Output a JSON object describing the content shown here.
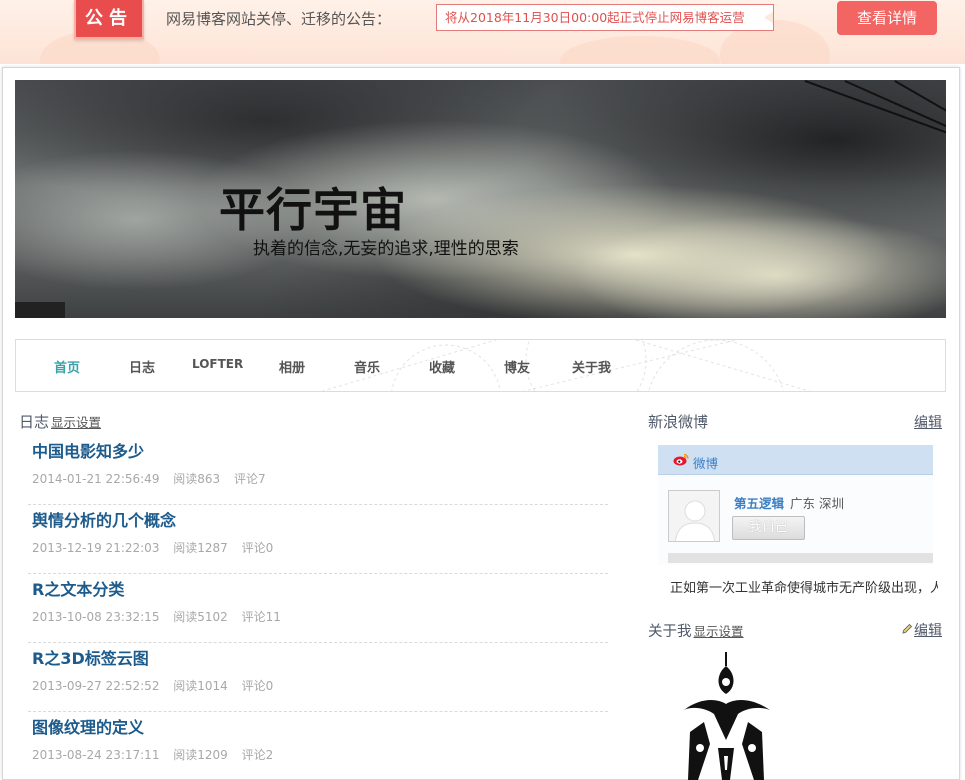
{
  "notice": {
    "tag": "公告",
    "text": "网易博客网站关停、迁移的公告：",
    "box_text": "将从2018年11月30日00:00起正式停止网易博客运营",
    "button": "查看详情"
  },
  "hero": {
    "title": "平行宇宙",
    "subtitle": "执着的信念,无妄的追求,理性的思索"
  },
  "nav": {
    "items": [
      "首页",
      "日志",
      "LOFTER",
      "相册",
      "音乐",
      "收藏",
      "博友",
      "关于我"
    ],
    "active": "首页"
  },
  "blog": {
    "heading": "日志",
    "settings_link": "显示设置",
    "posts": [
      {
        "title": "中国电影知多少",
        "date": "2014-01-21 22:56:49",
        "reads": "阅读863",
        "comments": "评论7"
      },
      {
        "title": "舆情分析的几个概念",
        "date": "2013-12-19 21:22:03",
        "reads": "阅读1287",
        "comments": "评论0"
      },
      {
        "title": "R之文本分类",
        "date": "2013-10-08 23:32:15",
        "reads": "阅读5102",
        "comments": "评论11"
      },
      {
        "title": "R之3D标签云图",
        "date": "2013-09-27 22:52:52",
        "reads": "阅读1014",
        "comments": "评论0"
      },
      {
        "title": "图像纹理的定义",
        "date": "2013-08-24 23:17:11",
        "reads": "阅读1209",
        "comments": "评论2"
      }
    ]
  },
  "weibo": {
    "heading": "新浪微博",
    "edit_link": "编辑",
    "bar_label": "微博",
    "user_name": "第五逻辑",
    "location": "广东 深圳",
    "self_button": "我自己",
    "post_text": "正如第一次工业革命使得城市无产阶级出现，人工"
  },
  "about": {
    "heading": "关于我",
    "settings_link": "显示设置",
    "edit_link": "编辑"
  },
  "colors": {
    "accent_red": "#f26563",
    "nav_active": "#3aa1a8",
    "post_title": "#1d5b8c",
    "weibo_blue": "#3c7fc4"
  }
}
